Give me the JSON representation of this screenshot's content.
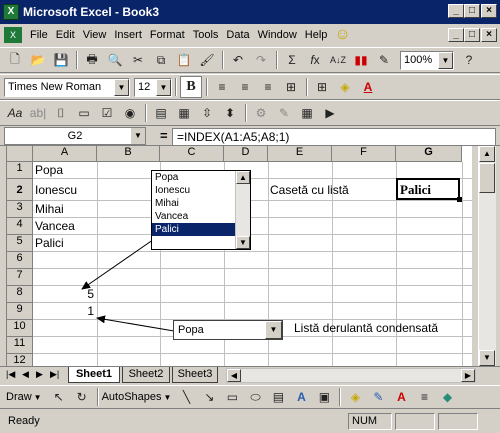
{
  "window": {
    "title": "Microsoft Excel - Book3",
    "app_icon": "excel-icon"
  },
  "menu": [
    "File",
    "Edit",
    "View",
    "Insert",
    "Format",
    "Tools",
    "Data",
    "Window",
    "Help"
  ],
  "toolbar": {
    "zoom": "100%",
    "font_name": "Times New Roman",
    "font_size": "12",
    "bold_label": "B"
  },
  "formula_bar": {
    "name_box": "G2",
    "equals": "=",
    "formula": "=INDEX(A1:A5;A8;1)"
  },
  "columns": [
    "A",
    "B",
    "C",
    "D",
    "E",
    "F",
    "G"
  ],
  "rows": [
    "1",
    "2",
    "3",
    "4",
    "5",
    "6",
    "7",
    "8",
    "9",
    "10",
    "11",
    "12"
  ],
  "cells": {
    "A1": "Popa",
    "A2": "Ionescu",
    "A3": "Mihai",
    "A4": "Vancea",
    "A5": "Palici",
    "A8": "5",
    "A9": "1",
    "E2": "Casetă cu listă",
    "G2": "Palici",
    "F10": "Listă derulantă condensată"
  },
  "listbox": {
    "items": [
      "Popa",
      "Ionescu",
      "Mihai",
      "Vancea",
      "Palici"
    ],
    "selected": "Palici"
  },
  "dropdown": {
    "value": "Popa"
  },
  "sheets": [
    "Sheet1",
    "Sheet2",
    "Sheet3"
  ],
  "drawing": {
    "draw_label": "Draw",
    "autoshapes_label": "AutoShapes"
  },
  "status": {
    "ready": "Ready",
    "num": "NUM"
  },
  "colors": {
    "title_bar": "#0a246a",
    "selection": "#0a246a",
    "chrome": "#d4d0c8"
  }
}
